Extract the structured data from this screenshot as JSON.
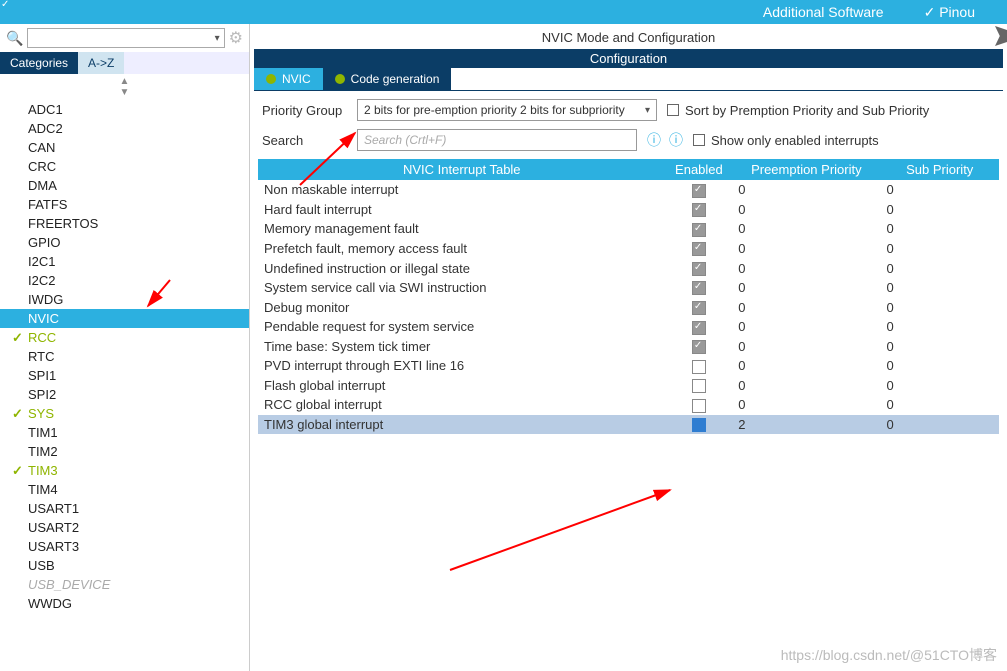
{
  "topbar": {
    "additional_software": "Additional Software",
    "pinout": "Pinou"
  },
  "sidebar": {
    "tabs": {
      "categories": "Categories",
      "az": "A->Z"
    },
    "items": [
      {
        "label": "ADC1"
      },
      {
        "label": "ADC2"
      },
      {
        "label": "CAN"
      },
      {
        "label": "CRC"
      },
      {
        "label": "DMA"
      },
      {
        "label": "FATFS"
      },
      {
        "label": "FREERTOS"
      },
      {
        "label": "GPIO"
      },
      {
        "label": "I2C1"
      },
      {
        "label": "I2C2"
      },
      {
        "label": "IWDG"
      },
      {
        "label": "NVIC",
        "selected": true
      },
      {
        "label": "RCC",
        "checked": true
      },
      {
        "label": "RTC"
      },
      {
        "label": "SPI1"
      },
      {
        "label": "SPI2"
      },
      {
        "label": "SYS",
        "checked": true
      },
      {
        "label": "TIM1"
      },
      {
        "label": "TIM2"
      },
      {
        "label": "TIM3",
        "checked": true
      },
      {
        "label": "TIM4"
      },
      {
        "label": "USART1"
      },
      {
        "label": "USART2"
      },
      {
        "label": "USART3"
      },
      {
        "label": "USB"
      },
      {
        "label": "USB_DEVICE",
        "dim": true
      },
      {
        "label": "WWDG"
      }
    ]
  },
  "content": {
    "panel_title": "NVIC Mode and Configuration",
    "section_title": "Configuration",
    "subtabs": {
      "nvic": "NVIC",
      "codegen": "Code generation"
    },
    "priority_label": "Priority Group",
    "priority_value": "2 bits for pre-emption priority 2 bits for subpriority",
    "sort_label": "Sort by Premption Priority and Sub Priority",
    "search_label": "Search",
    "search_placeholder": "Search (Crtl+F)",
    "show_enabled_label": "Show only enabled interrupts",
    "table": {
      "headers": {
        "name": "NVIC Interrupt Table",
        "enabled": "Enabled",
        "preempt": "Preemption Priority",
        "sub": "Sub Priority"
      },
      "rows": [
        {
          "name": "Non maskable interrupt",
          "enabled": true,
          "locked": true,
          "pre": "0",
          "sub": "0"
        },
        {
          "name": "Hard fault interrupt",
          "enabled": true,
          "locked": true,
          "pre": "0",
          "sub": "0"
        },
        {
          "name": "Memory management fault",
          "enabled": true,
          "locked": true,
          "pre": "0",
          "sub": "0"
        },
        {
          "name": "Prefetch fault, memory access fault",
          "enabled": true,
          "locked": true,
          "pre": "0",
          "sub": "0"
        },
        {
          "name": "Undefined instruction or illegal state",
          "enabled": true,
          "locked": true,
          "pre": "0",
          "sub": "0"
        },
        {
          "name": "System service call via SWI instruction",
          "enabled": true,
          "locked": true,
          "pre": "0",
          "sub": "0"
        },
        {
          "name": "Debug monitor",
          "enabled": true,
          "locked": true,
          "pre": "0",
          "sub": "0"
        },
        {
          "name": "Pendable request for system service",
          "enabled": true,
          "locked": true,
          "pre": "0",
          "sub": "0"
        },
        {
          "name": "Time base: System tick timer",
          "enabled": true,
          "locked": true,
          "pre": "0",
          "sub": "0"
        },
        {
          "name": "PVD interrupt through EXTI line 16",
          "enabled": false,
          "pre": "0",
          "sub": "0"
        },
        {
          "name": "Flash global interrupt",
          "enabled": false,
          "pre": "0",
          "sub": "0"
        },
        {
          "name": "RCC global interrupt",
          "enabled": false,
          "pre": "0",
          "sub": "0"
        },
        {
          "name": "TIM3 global interrupt",
          "enabled": true,
          "blue": true,
          "hl": true,
          "pre": "2",
          "sub": "0"
        }
      ]
    }
  },
  "watermark": "https://blog.csdn.net/@51CTO博客"
}
